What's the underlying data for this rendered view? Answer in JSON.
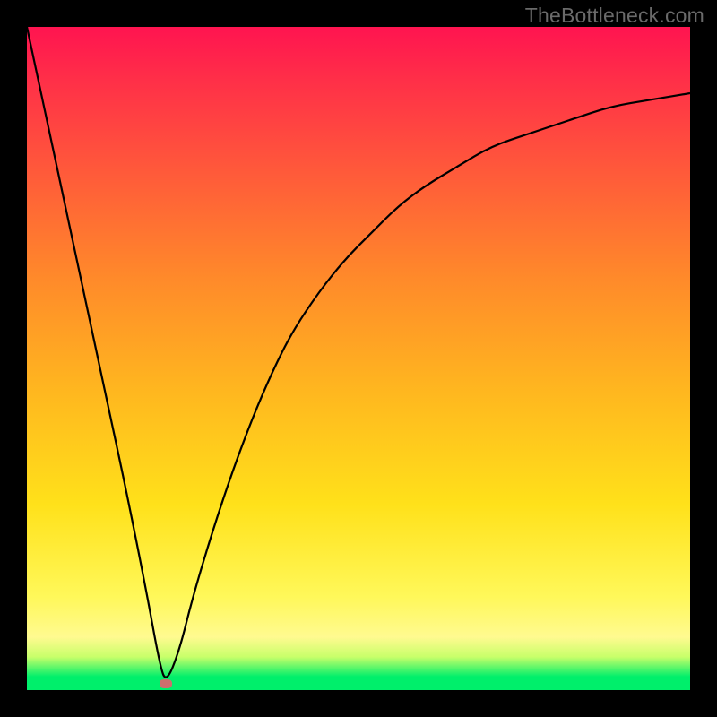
{
  "watermark": "TheBottleneck.com",
  "colors": {
    "frame": "#000000",
    "curve": "#000000",
    "marker": "#cc6f6e",
    "gradient_stops": [
      "#ff1450",
      "#ff2f48",
      "#ff5a3a",
      "#ff8a2a",
      "#ffb71f",
      "#ffe11a",
      "#fff85a",
      "#fffa90",
      "#c8ff6a",
      "#00ef6b"
    ]
  },
  "chart_data": {
    "type": "line",
    "title": "",
    "xlabel": "",
    "ylabel": "",
    "xlim": [
      0,
      100
    ],
    "ylim": [
      0,
      100
    ],
    "grid": false,
    "note": "Axes are unlabeled; values below are normalized 0-100 for both axes, estimated from pixel positions. Curve starts at top-left, drops sharply to a minimum near x≈21, then rises with decreasing slope toward the right edge near y≈90.",
    "series": [
      {
        "name": "bottleneck-curve",
        "x": [
          0,
          3,
          6,
          9,
          12,
          15,
          18,
          20,
          21,
          23,
          25,
          28,
          31,
          34,
          37,
          40,
          44,
          48,
          52,
          56,
          60,
          65,
          70,
          76,
          82,
          88,
          94,
          100
        ],
        "y": [
          100,
          86,
          72,
          58,
          44,
          30,
          15,
          4,
          1,
          6,
          14,
          24,
          33,
          41,
          48,
          54,
          60,
          65,
          69,
          73,
          76,
          79,
          82,
          84,
          86,
          88,
          89,
          90
        ]
      }
    ],
    "annotation": {
      "name": "minimum-marker",
      "x": 21,
      "y": 1,
      "color": "#cc6f6e"
    }
  }
}
